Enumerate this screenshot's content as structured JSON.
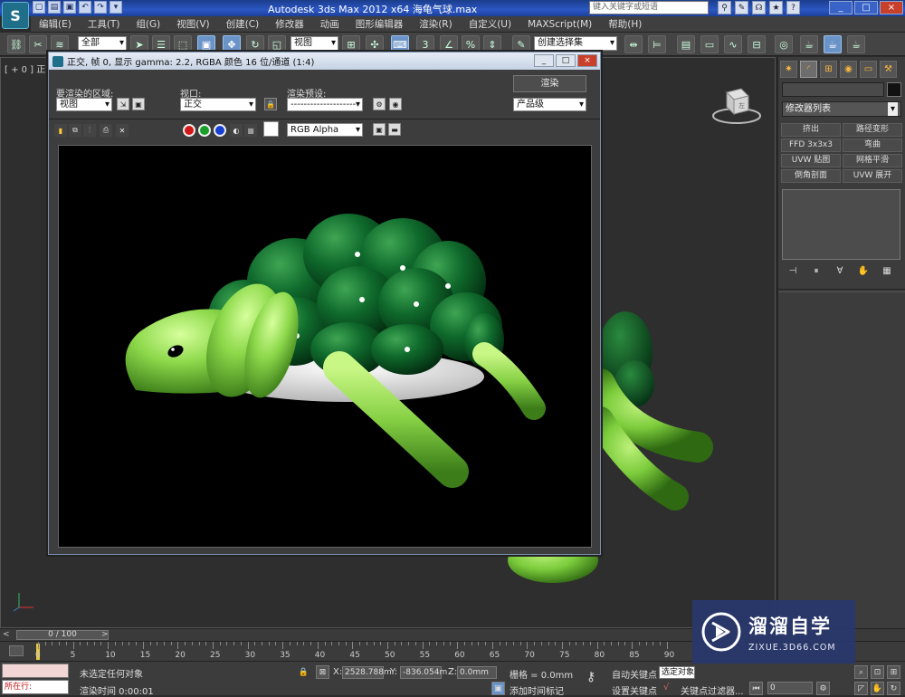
{
  "window": {
    "title": "Autodesk 3ds Max  2012 x64     海龟气球.max",
    "search_placeholder": "键入关键字或短语",
    "controls": [
      "_",
      "□",
      "×"
    ]
  },
  "menu": [
    "编辑(E)",
    "工具(T)",
    "组(G)",
    "视图(V)",
    "创建(C)",
    "修改器",
    "动画",
    "图形编辑器",
    "渲染(R)",
    "自定义(U)",
    "MAXScript(M)",
    "帮助(H)"
  ],
  "toolbar": {
    "selection_filter": "全部",
    "ref_coord": "视图",
    "named_selection": "创建选择集"
  },
  "viewport": {
    "label": "[ + 0 ] 正交",
    "viewcube_label": "左"
  },
  "render_window": {
    "title": "正交, 帧 0, 显示 gamma: 2.2, RGBA 颜色 16 位/通道 (1:4)",
    "area_label": "要渲染的区域:",
    "area_value": "视图",
    "viewport_label": "视口:",
    "viewport_value": "正交",
    "preset_label": "渲染预设:",
    "preset_value": "--------------------",
    "render_button": "渲染",
    "quality_value": "产品级",
    "channel_value": "RGB Alpha"
  },
  "command_panel": {
    "modifier_list": "修改器列表",
    "buttons": [
      "挤出",
      "路径变形",
      "FFD 3x3x3",
      "弯曲",
      "UVW 贴图",
      "网格平滑",
      "倒角剖面",
      "UVW 展开"
    ]
  },
  "timeline": {
    "frame_display": "0 / 100",
    "ticks": [
      "0",
      "5",
      "10",
      "15",
      "20",
      "25",
      "30",
      "35",
      "40",
      "45",
      "50",
      "55",
      "60",
      "65",
      "70",
      "75",
      "80",
      "85",
      "90"
    ]
  },
  "status": {
    "maxscript_label": "所在行:",
    "selection_status": "未选定任何对象",
    "render_time": "渲染时间  0:00:01",
    "x_label": "X:",
    "x_value": "2528.788m",
    "y_label": "Y:",
    "y_value": "-836.054m",
    "z_label": "Z:",
    "z_value": "0.0mm",
    "grid": "栅格 = 0.0mm",
    "auto_key": "自动关键点",
    "auto_key_value": "选定对象",
    "set_key": "设置关键点",
    "key_filters": "关键点过滤器...",
    "add_time_tag": "添加时间标记",
    "frame_input": "0"
  },
  "watermark": {
    "cn": "溜溜自学",
    "en": "ZIXUE.3D66.COM"
  },
  "colors": {
    "title_bar": "#2b57c4",
    "turtle_shell": "#0d5a22",
    "turtle_body": "#8fd94a",
    "belly": "#f4f4f4"
  }
}
